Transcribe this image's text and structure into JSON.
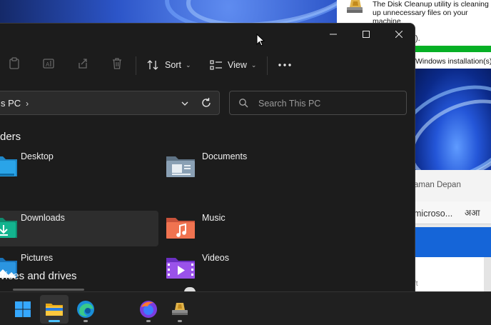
{
  "background_cleanup": {
    "message": "The Disk Cleanup utility is cleaning up unnecessary files on your machine.",
    "dot": ").",
    "progress_fraction": 1.0,
    "status": "Windows installation(s)"
  },
  "background_browser": {
    "tab_label": "aman Depan",
    "address_text": "microso...",
    "read_aloud_glyph": "अआ",
    "footer_text": "ft"
  },
  "explorer": {
    "toolbar": {
      "sort_label": "Sort",
      "view_label": "View"
    },
    "address": {
      "crumb": "s PC",
      "separator": "›"
    },
    "search": {
      "placeholder": "Search This PC"
    },
    "folders_heading": "ders",
    "folders": [
      {
        "label": "Desktop",
        "icon": "desktop-folder-icon"
      },
      {
        "label": "Documents",
        "icon": "documents-folder-icon"
      },
      {
        "label": "Downloads",
        "icon": "downloads-folder-icon",
        "selected": true
      },
      {
        "label": "Music",
        "icon": "music-folder-icon"
      },
      {
        "label": "Pictures",
        "icon": "pictures-folder-icon"
      },
      {
        "label": "Videos",
        "icon": "videos-folder-icon"
      }
    ],
    "drives_heading": "vices and drives"
  },
  "taskbar": {
    "apps": [
      {
        "name": "start-icon"
      },
      {
        "name": "file-explorer-icon",
        "state": "focused"
      },
      {
        "name": "edge-icon",
        "state": "running"
      },
      {
        "name": "empty-slot"
      },
      {
        "name": "firefox-icon",
        "state": "running"
      },
      {
        "name": "disk-cleanup-icon",
        "state": "running"
      }
    ]
  },
  "colors": {
    "explorer_bg": "#1c1c1c",
    "accent": "#4cc2ff",
    "progress_green": "#06b025",
    "browser_blue": "#1565d8"
  }
}
